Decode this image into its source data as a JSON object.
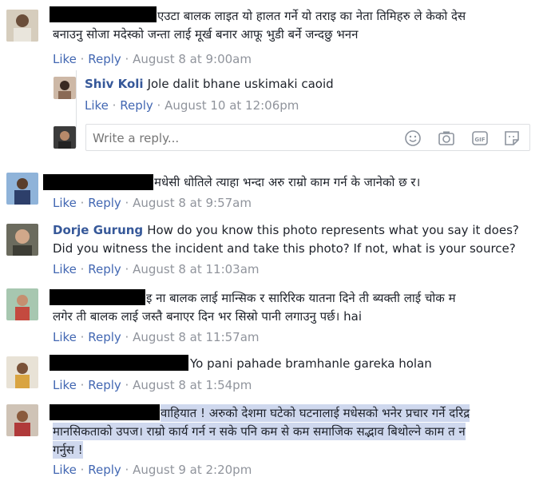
{
  "actions": {
    "like": "Like",
    "reply": "Reply",
    "sep": " · "
  },
  "comments": [
    {
      "text_line1": "एउटा बालक लाइत यो हालत गर्ने यो तराइ का नेता तिमिहरु ले केको देस",
      "text_line2": "बनाउनु सोजा मदेस्को जन्ता लाई मूर्ख बनार आफू भुडी बर्ने जन्दछु भनन",
      "date": "August 8 at 9:00am"
    },
    {
      "name": "Shiv Koli",
      "text": "Jole dalit bhane uskimaki caoid",
      "date": "August 10 at 12:06pm"
    },
    {
      "text": "मधेसी धोतिले त्याहा भन्दा अरु राम्रो काम गर्न के जानेको छ र।",
      "date": "August 8 at 9:57am"
    },
    {
      "name": "Dorje Gurung",
      "text_line1": "How do you know this photo represents what you say it does?",
      "text_line2": "Did you witness the incident and take this photo? If not, what is your source?",
      "date": "August 8 at 11:03am"
    },
    {
      "text_line1": "इ ना बालक लाई मान्सिक र सारिरिक यातना दिने ती ब्यक्ती लाई चोक म",
      "text_line2": "लगेर ती बालक लाई जस्तै बनाएर दिन भर सिस्रो पानी लगाउनु पर्छ। hai",
      "date": "August 8 at 11:57am"
    },
    {
      "text": "Yo pani pahade bramhanle gareka holan",
      "date": "August 8 at 1:54pm"
    },
    {
      "text_line1": "वाहियात ! अरुको देशमा घटेको घटनालाई मधेसको भनेर प्रचार गर्ने दरिद्र",
      "text_line2": "मानसिकताको उपज। राम्रो कार्य गर्न न सके पनि कम से कम समाजिक सद्भाव बिथोल्ने काम त न",
      "text_line3": "गर्नुस !",
      "date": "August 9 at 2:20pm"
    }
  ],
  "reply_box": {
    "placeholder": "Write a reply..."
  },
  "icons": [
    "emoji-icon",
    "camera-icon",
    "gif-icon",
    "sticker-icon"
  ]
}
